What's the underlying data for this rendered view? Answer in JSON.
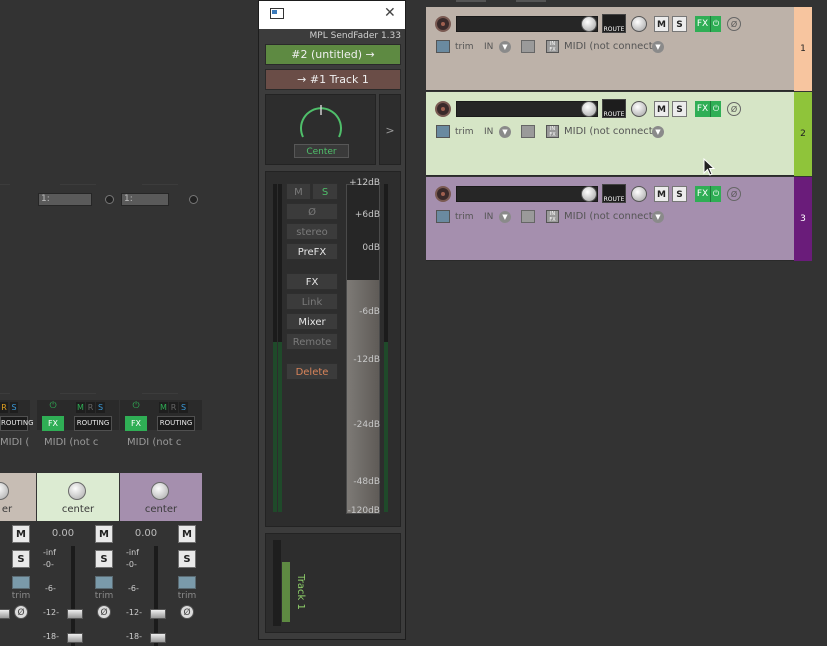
{
  "mixer": {
    "inputs": [
      "1:",
      "1:"
    ],
    "strips": [
      {
        "fx": "FX",
        "power": "⏻",
        "m": "M",
        "r": "R",
        "s": "S",
        "routing": "ROUTING",
        "midi": "MIDI (not c",
        "pan": "center",
        "volume": "0.00",
        "mute": "M",
        "solo": "S",
        "trim": "trim",
        "scale": [
          "-inf",
          "-0-",
          "-6-",
          "-12-",
          "-18-"
        ],
        "color": "#dcebd2"
      },
      {
        "fx": "FX",
        "power": "⏻",
        "m": "M",
        "r": "R",
        "s": "S",
        "routing": "ROUTING",
        "midi": "MIDI (not c",
        "pan": "center",
        "volume": "0.00",
        "mute": "M",
        "solo": "S",
        "trim": "trim",
        "scale": [
          "-inf",
          "-0-",
          "-6-",
          "-12-",
          "-18-"
        ],
        "color": "#a58fae"
      }
    ],
    "partial_strip": {
      "r": "R",
      "s": "S",
      "routing": "ROUTING",
      "midi": "MIDI (not c",
      "pan": "er",
      "mute": "M",
      "solo": "S",
      "trim": "trim"
    }
  },
  "sendfader": {
    "title": "MPL SendFader  1.33",
    "source": "#2 (untitled) →",
    "dest": "→ #1 Track 1",
    "pan_label": "Center",
    "arrow": ">",
    "buttons": {
      "mute": "M",
      "solo": "S",
      "phase": "Ø",
      "stereo": "stereo",
      "prefx": "PreFX",
      "fx": "FX",
      "link": "Link",
      "mixer": "Mixer",
      "remote": "Remote",
      "delete": "Delete"
    },
    "db_scale": [
      "+12dB",
      "+6dB",
      "0dB",
      "-6dB",
      "-12dB",
      "-24dB",
      "-48dB",
      "-120dB"
    ],
    "send_track": "Track 1"
  },
  "tracks": [
    {
      "number": "1",
      "color": "#bdb2a9",
      "strip_color": "#f7c59f",
      "fx": "FX",
      "power": "⏻",
      "mute": "M",
      "solo": "S",
      "route": "ROUTE",
      "trim": "trim",
      "in": "IN",
      "midi": "MIDI (not connecte",
      "midi_icon": "IN FX"
    },
    {
      "number": "2",
      "color": "#d6e5c6",
      "strip_color": "#8fc43a",
      "fx": "FX",
      "power": "⏻",
      "mute": "M",
      "solo": "S",
      "route": "ROUTE",
      "trim": "trim",
      "in": "IN",
      "midi": "MIDI (not connecte",
      "midi_icon": "IN FX"
    },
    {
      "number": "3",
      "color": "#a58fae",
      "strip_color": "#6a1c7a",
      "fx": "FX",
      "power": "⏻",
      "mute": "M",
      "solo": "S",
      "route": "ROUTE",
      "trim": "trim",
      "in": "IN",
      "midi": "MIDI (not connecte",
      "midi_icon": "IN FX"
    }
  ]
}
